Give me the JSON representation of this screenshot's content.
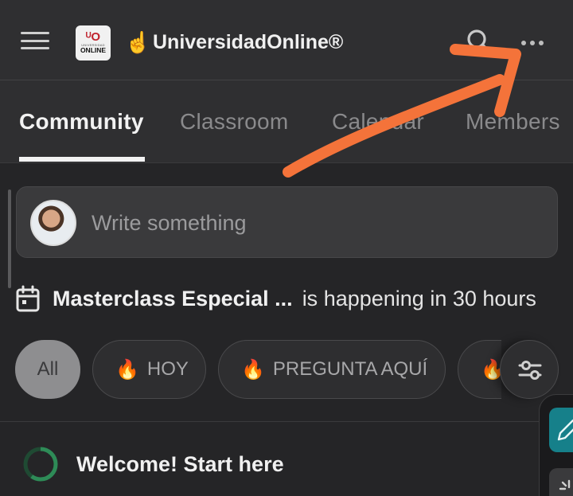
{
  "header": {
    "logo_word": "ONLINE",
    "logo_small": "UNIVERSIDAD",
    "brand_emoji": "☝️",
    "community_name": "UniversidadOnline®",
    "icons": [
      "menu-icon",
      "search-icon",
      "more-dots-icon"
    ]
  },
  "tabs": [
    {
      "label": "Community",
      "active": true
    },
    {
      "label": "Classroom",
      "active": false
    },
    {
      "label": "Calendar",
      "active": false
    },
    {
      "label": "Members",
      "active": false
    }
  ],
  "composer": {
    "placeholder": "Write something"
  },
  "event": {
    "title": "Masterclass Especial ...",
    "status": "is happening in 30 hours"
  },
  "filters": [
    {
      "label": "All",
      "emoji": "",
      "selected": true
    },
    {
      "label": "HOY",
      "emoji": "🔥",
      "selected": false
    },
    {
      "label": "PREGUNTA AQUÍ",
      "emoji": "🔥",
      "selected": false
    },
    {
      "label": "",
      "emoji": "🔥",
      "selected": false
    }
  ],
  "welcome": {
    "label": "Welcome! Start here",
    "progress": 0.6
  },
  "colors": {
    "accent_teal": "#16808a",
    "annotation_orange": "#f4733a",
    "progress_green": "#2e8b57"
  }
}
